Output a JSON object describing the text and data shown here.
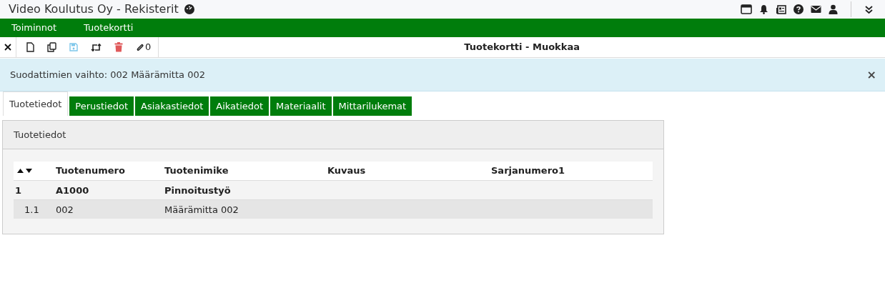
{
  "app_title": "Video Koulutus Oy - Rekisterit",
  "menu": [
    "Toiminnot",
    "Tuotekortti"
  ],
  "toolbar": {
    "attachment_count": "0",
    "title": "Tuotekortti - Muokkaa"
  },
  "alert": {
    "message": "Suodattimien vaihto: 002 Määrämitta 002",
    "close": "×"
  },
  "tabs": [
    {
      "label": "Tuotetiedot",
      "selected": true
    },
    {
      "label": "Perustiedot",
      "selected": false
    },
    {
      "label": "Asiakastiedot",
      "selected": false
    },
    {
      "label": "Aikatiedot",
      "selected": false
    },
    {
      "label": "Materiaalit",
      "selected": false
    },
    {
      "label": "Mittarilukemat",
      "selected": false
    }
  ],
  "panel": {
    "title": "Tuotetiedot",
    "table": {
      "columns": [
        "",
        "Tuotenumero",
        "Tuotenimike",
        "Kuvaus",
        "Sarjanumero1"
      ],
      "rows": [
        {
          "cells": [
            "1",
            "A1000",
            "Pinnoitustyö",
            "",
            ""
          ],
          "children": [
            {
              "cells": [
                "1.1",
                "002",
                "Määrämitta 002",
                "",
                ""
              ]
            }
          ]
        }
      ]
    }
  }
}
